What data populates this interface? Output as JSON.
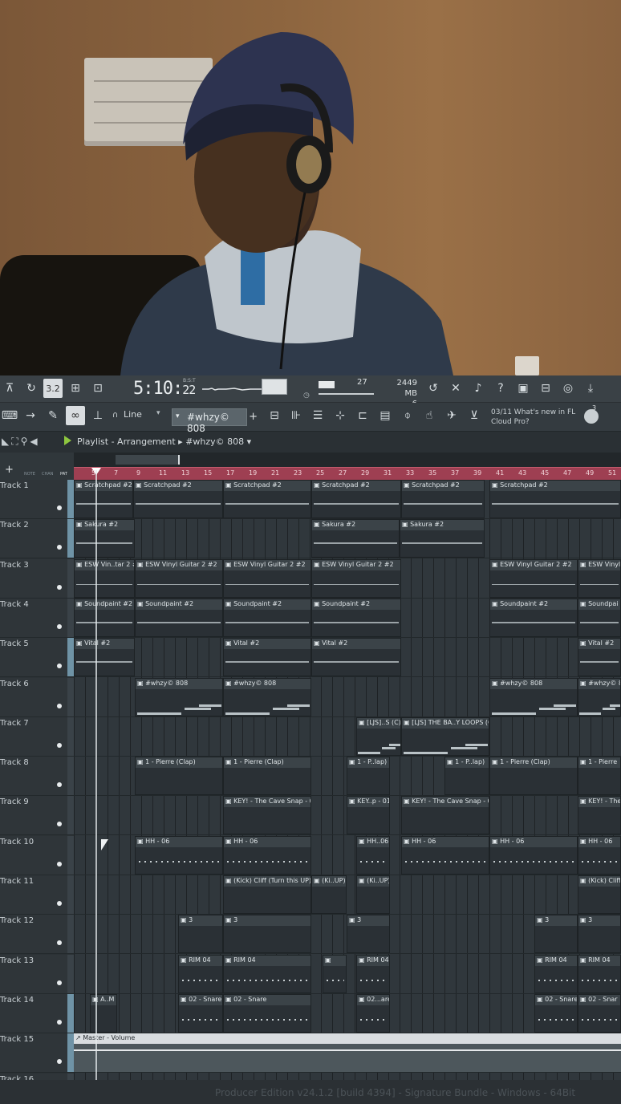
{
  "toolbar": {
    "time": "5:10",
    "time_sub": "22",
    "time_label": "B:S:T",
    "cpu": "27",
    "memory": "2449 MB",
    "polyphony": "6",
    "snap_label": "Line",
    "pattern_name": "#whzy© 808",
    "news_line1": "03/11  What's new in FL",
    "news_line2": "Cloud Pro?",
    "news_count": "3",
    "tempo_button": "3.2",
    "colors": {
      "accent": "#8ec63f",
      "ruler": "#9e3f52"
    }
  },
  "playlist": {
    "title": "Playlist - Arrangement",
    "pattern": "#whzy© 808",
    "tool_labels": [
      "NOTE",
      "CHAN",
      "PAT"
    ],
    "ruler_marks": [
      "5",
      "7",
      "9",
      "11",
      "13",
      "15",
      "17",
      "19",
      "21",
      "23",
      "25",
      "27",
      "29",
      "31",
      "33",
      "35",
      "37",
      "39",
      "41",
      "43",
      "45",
      "47",
      "49",
      "51"
    ]
  },
  "tracks": [
    {
      "name": "Track 1",
      "clips": [
        {
          "label": "Scratchpad #2",
          "kind": "wave"
        },
        {
          "label": "Scratchpad #2",
          "kind": "wave"
        },
        {
          "label": "Scratchpad #2",
          "kind": "wave"
        },
        {
          "label": "Scratchpad #2",
          "kind": "wave"
        },
        {
          "label": "Scratchpad #2",
          "kind": "wave"
        },
        {
          "label": "Scratchpad #2",
          "kind": "wave"
        }
      ]
    },
    {
      "name": "Track 2",
      "clips": [
        {
          "label": "Sakura #2",
          "kind": "wave"
        },
        {
          "label": "Sakura #2",
          "kind": "wave"
        },
        {
          "label": "Sakura #2",
          "kind": "wave"
        }
      ]
    },
    {
      "name": "Track 3",
      "clips": [
        {
          "label": "ESW Vin..tar 2 #2",
          "kind": "wave"
        },
        {
          "label": "ESW Vinyl Guitar 2 #2",
          "kind": "wave"
        },
        {
          "label": "ESW Vinyl Guitar 2 #2",
          "kind": "wave"
        },
        {
          "label": "ESW Vinyl Guitar 2 #2",
          "kind": "wave"
        },
        {
          "label": "ESW Vinyl Guitar 2 #2",
          "kind": "wave"
        },
        {
          "label": "ESW Vinyl",
          "kind": "wave"
        }
      ]
    },
    {
      "name": "Track 4",
      "clips": [
        {
          "label": "Soundpaint #2",
          "kind": "wave"
        },
        {
          "label": "Soundpaint #2",
          "kind": "wave"
        },
        {
          "label": "Soundpaint #2",
          "kind": "wave"
        },
        {
          "label": "Soundpaint #2",
          "kind": "wave"
        },
        {
          "label": "Soundpaint #2",
          "kind": "wave"
        },
        {
          "label": "Soundpai",
          "kind": "wave"
        }
      ]
    },
    {
      "name": "Track 5",
      "clips": [
        {
          "label": "Vital #2",
          "kind": "wave"
        },
        {
          "label": "Vital #2",
          "kind": "wave"
        },
        {
          "label": "Vital #2",
          "kind": "wave"
        },
        {
          "label": "Vital #2",
          "kind": "wave"
        }
      ]
    },
    {
      "name": "Track 6",
      "clips": [
        {
          "label": "#whzy© 808",
          "kind": "notes"
        },
        {
          "label": "#whzy© 808",
          "kind": "notes"
        },
        {
          "label": "#whzy© 808",
          "kind": "notes"
        },
        {
          "label": "#whzy© 8",
          "kind": "notes"
        }
      ]
    },
    {
      "name": "Track 7",
      "clips": [
        {
          "label": "[LJS]..S (C)",
          "kind": "notes"
        },
        {
          "label": "[LJS] THE BA..Y LOOPS (C)",
          "kind": "notes"
        }
      ]
    },
    {
      "name": "Track 8",
      "clips": [
        {
          "label": "1 - Pierre (Clap)",
          "kind": "empty"
        },
        {
          "label": "1 - Pierre (Clap)",
          "kind": "empty"
        },
        {
          "label": "1 - P..lap)",
          "kind": "empty"
        },
        {
          "label": "1 - P..lap)",
          "kind": "empty"
        },
        {
          "label": "1 - Pierre (Clap)",
          "kind": "empty"
        },
        {
          "label": "1 - Pierre",
          "kind": "empty"
        }
      ]
    },
    {
      "name": "Track 9",
      "clips": [
        {
          "label": "KEY! - The Cave Snap - 01",
          "kind": "empty"
        },
        {
          "label": "KEY..p - 01",
          "kind": "empty"
        },
        {
          "label": "KEY! - The Cave Snap - 01",
          "kind": "empty"
        },
        {
          "label": "KEY! - The",
          "kind": "empty"
        }
      ]
    },
    {
      "name": "Track 10",
      "clips": [
        {
          "label": "HH - 06",
          "kind": "dots"
        },
        {
          "label": "HH - 06",
          "kind": "dots"
        },
        {
          "label": "HH..06",
          "kind": "dots"
        },
        {
          "label": "HH - 06",
          "kind": "dots"
        },
        {
          "label": "HH - 06",
          "kind": "dots"
        },
        {
          "label": "HH - 06",
          "kind": "dots"
        }
      ]
    },
    {
      "name": "Track 11",
      "clips": [
        {
          "label": "(Kick) Cliff (Turn this UP)",
          "kind": "empty"
        },
        {
          "label": "(Ki..UP)",
          "kind": "empty"
        },
        {
          "label": "(Ki..UP)",
          "kind": "empty"
        },
        {
          "label": "(Kick) Cliff",
          "kind": "empty"
        }
      ]
    },
    {
      "name": "Track 12",
      "clips": [
        {
          "label": "3",
          "kind": "empty"
        },
        {
          "label": "3",
          "kind": "empty"
        },
        {
          "label": "3",
          "kind": "empty"
        },
        {
          "label": "3",
          "kind": "empty"
        },
        {
          "label": "3",
          "kind": "empty"
        }
      ]
    },
    {
      "name": "Track 13",
      "clips": [
        {
          "label": "RIM 04",
          "kind": "dots"
        },
        {
          "label": "RIM 04",
          "kind": "dots"
        },
        {
          "label": "",
          "kind": "dots"
        },
        {
          "label": "RIM 04",
          "kind": "dots"
        },
        {
          "label": "RIM 04",
          "kind": "dots"
        },
        {
          "label": "RIM 04",
          "kind": "dots"
        }
      ]
    },
    {
      "name": "Track 14",
      "clips": [
        {
          "label": "A..M",
          "kind": "empty"
        },
        {
          "label": "02 - Snare",
          "kind": "dots"
        },
        {
          "label": "02 - Snare",
          "kind": "dots"
        },
        {
          "label": "02...are",
          "kind": "dots"
        },
        {
          "label": "02 - Snare",
          "kind": "dots"
        },
        {
          "label": "02 - Snar",
          "kind": "dots"
        }
      ]
    },
    {
      "name": "Track 15",
      "clips": [
        {
          "label": "Master - Volume",
          "kind": "master"
        }
      ]
    },
    {
      "name": "Track 16",
      "clips": []
    }
  ],
  "status_bar": "Producer Edition v24.1.2 [build 4394] - Signature Bundle - Windows - 64Bit"
}
